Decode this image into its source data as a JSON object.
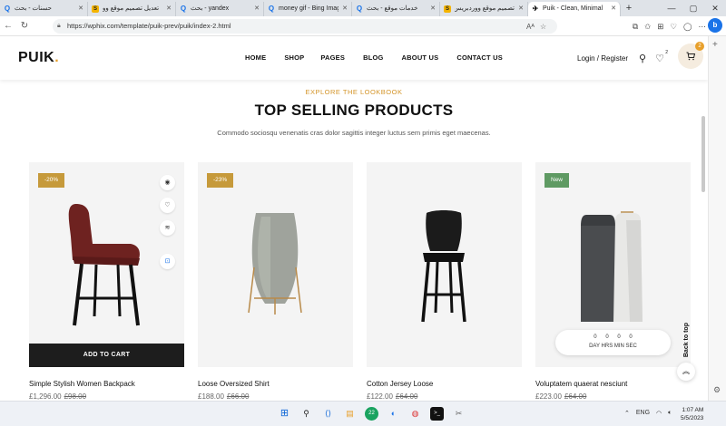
{
  "browser": {
    "tabs": [
      {
        "title": "حسنات - بحث",
        "icon": "search-icon",
        "active": false
      },
      {
        "title": "تعديل تصميم موقع وو",
        "icon": "s-favicon",
        "active": false
      },
      {
        "title": "yandex - بحث",
        "icon": "search-icon",
        "active": false
      },
      {
        "title": "money gif - Bing Imag",
        "icon": "search-icon",
        "active": false
      },
      {
        "title": "خدمات موقع - بحث",
        "icon": "search-icon",
        "active": false
      },
      {
        "title": "تصميم موقع ووردبريس",
        "icon": "s-favicon",
        "active": false
      },
      {
        "title": "Puik - Clean, Minimal",
        "icon": "puik-favicon",
        "active": true
      }
    ],
    "url": "https://wphix.com/template/puik-prev/puik/index-2.html",
    "bing_badge": "b"
  },
  "site": {
    "logo": "PUIK",
    "logo_dot": ".",
    "menu": [
      "HOME",
      "SHOP",
      "PAGES",
      "BLOG",
      "ABOUT US",
      "CONTACT US"
    ],
    "login": "Login / Register",
    "wishlist_count": "2",
    "cart_count": "2",
    "eyebrow": "EXPLORE THE LOOKBOOK",
    "title": "TOP SELLING PRODUCTS",
    "subtitle": "Commodo sociosqu venenatis cras dolor sagittis integer luctus sem primis eget maecenas.",
    "add_to_cart": "ADD TO CART",
    "back_to_top": "Back to top",
    "products": [
      {
        "badge": "-20%",
        "name": "Simple Stylish Women Backpack",
        "price": "£1,296.00",
        "old_price": "£98.00"
      },
      {
        "badge": "-23%",
        "name": "Loose Oversized Shirt",
        "price": "£188.00",
        "old_price": "£66.00"
      },
      {
        "name": "Cotton Jersey Loose",
        "price": "£122.00",
        "old_price": "£64.00"
      },
      {
        "badge": "New",
        "name": "Voluptatem quaerat nesciunt",
        "price": "£223.00",
        "old_price": "£64.00"
      }
    ],
    "countdown": {
      "values": [
        "0",
        "0",
        "0",
        "0"
      ],
      "labels": "DAY HRS MIN SEC"
    }
  },
  "taskbar": {
    "lang": "ENG",
    "time": "1:07 AM",
    "date": "5/5/2023",
    "chat_badge": "22"
  },
  "colors": {
    "accent": "#d4952a",
    "badge_gold": "#c69a3b",
    "badge_green": "#5f9a63",
    "chair_red": "#6e2220"
  }
}
